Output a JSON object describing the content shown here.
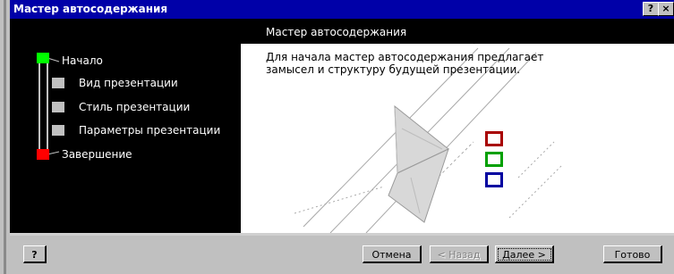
{
  "window": {
    "title": "Мастер автосодержания",
    "help_button": "?",
    "close_button": "×"
  },
  "steps": [
    {
      "label": "Начало",
      "marker_color": "#00ff00"
    },
    {
      "label": "Вид презентации",
      "marker_color": "#c0c0c0"
    },
    {
      "label": "Стиль презентации",
      "marker_color": "#c0c0c0"
    },
    {
      "label": "Параметры презентации",
      "marker_color": "#c0c0c0"
    },
    {
      "label": "Завершение",
      "marker_color": "#ff0000"
    }
  ],
  "panel": {
    "heading": "Мастер автосодержания",
    "description": "Для начала мастер автосодержания предлагает замысел и структуру будущей презентации."
  },
  "buttons": {
    "help": "?",
    "cancel": "Отмена",
    "back": "< Назад",
    "next": "Далее >",
    "finish": "Готово"
  },
  "colors": {
    "titlebar": "#0000a8",
    "square_red": "#a80000",
    "square_green": "#00a000",
    "square_blue": "#0000a0"
  }
}
